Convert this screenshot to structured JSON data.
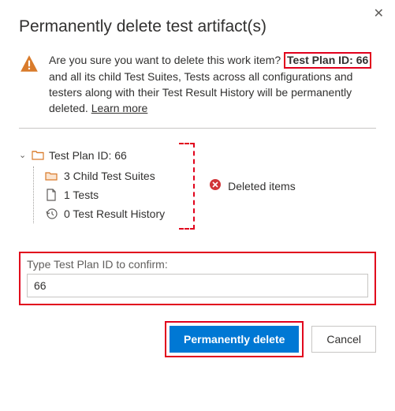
{
  "dialog": {
    "title": "Permanently delete test artifact(s)",
    "message_pre": "Are you sure you want to delete this work item? ",
    "message_highlight": "Test Plan ID: 66",
    "message_post": " and all its child Test Suites, Tests across all configurations and testers along with their Test Result History will be permanently deleted. ",
    "learn_more": "Learn more"
  },
  "tree": {
    "root_label": "Test Plan ID: 66",
    "children": [
      {
        "icon": "folder",
        "label": "3 Child Test Suites"
      },
      {
        "icon": "document",
        "label": "1 Tests"
      },
      {
        "icon": "history",
        "label": "0 Test Result History"
      }
    ]
  },
  "deleted_items_label": "Deleted items",
  "confirm": {
    "label": "Type Test Plan ID to confirm:",
    "value": "66"
  },
  "buttons": {
    "primary": "Permanently delete",
    "secondary": "Cancel"
  }
}
